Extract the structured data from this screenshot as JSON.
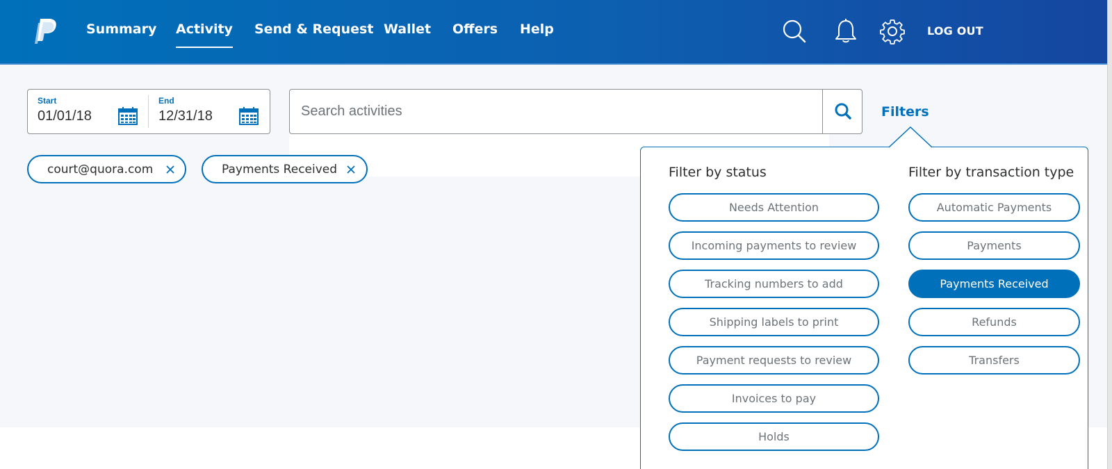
{
  "header": {
    "logo_icon": "paypal-logo",
    "nav": [
      {
        "label": "Summary",
        "active": false
      },
      {
        "label": "Activity",
        "active": true
      },
      {
        "label": "Send & Request",
        "active": false
      },
      {
        "label": "Wallet",
        "active": false
      },
      {
        "label": "Offers",
        "active": false
      },
      {
        "label": "Help",
        "active": false
      }
    ],
    "icons": [
      "search-icon",
      "bell-icon",
      "gear-icon"
    ],
    "logout_label": "LOG OUT"
  },
  "date_range": {
    "start_label": "Start",
    "start_value": "01/01/18",
    "end_label": "End",
    "end_value": "12/31/18"
  },
  "search": {
    "placeholder": "Search activities",
    "value": ""
  },
  "filters_label": "Filters",
  "active_filters": [
    {
      "label": "court@quora.com"
    },
    {
      "label": "Payments Received"
    }
  ],
  "filter_panel": {
    "status_title": "Filter by status",
    "status_options": [
      "Needs Attention",
      "Incoming payments to review",
      "Tracking numbers to add",
      "Shipping labels to print",
      "Payment requests to review",
      "Invoices to pay",
      "Holds"
    ],
    "type_title": "Filter by transaction type",
    "type_options": [
      {
        "label": "Automatic Payments",
        "selected": false
      },
      {
        "label": "Payments",
        "selected": false
      },
      {
        "label": "Payments Received",
        "selected": true
      },
      {
        "label": "Refunds",
        "selected": false
      },
      {
        "label": "Transfers",
        "selected": false
      }
    ]
  },
  "colors": {
    "brand_blue": "#0070ba",
    "header_dark": "#1546a0",
    "background": "#f5f7fa"
  }
}
